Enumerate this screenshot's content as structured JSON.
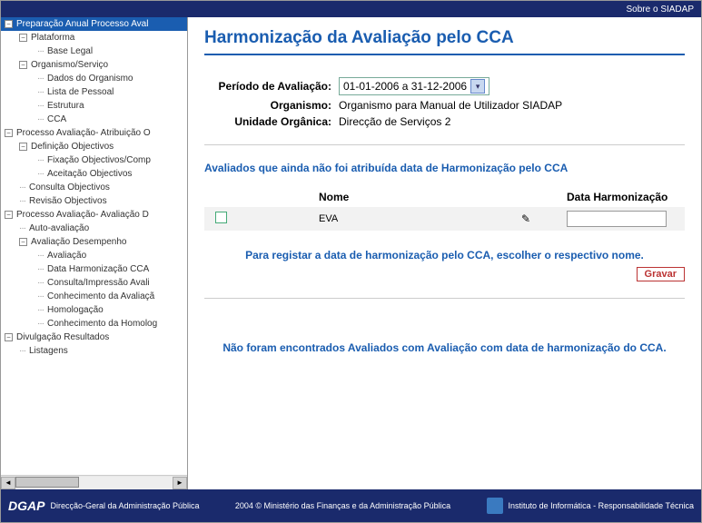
{
  "topbar": {
    "about": "Sobre o SIADAP"
  },
  "tree": [
    {
      "lvl": 0,
      "tog": "−",
      "label": "Preparação Anual Processo Aval",
      "sel": true
    },
    {
      "lvl": 1,
      "tog": "−",
      "label": "Plataforma"
    },
    {
      "lvl": 2,
      "label": "Base Legal"
    },
    {
      "lvl": 1,
      "tog": "−",
      "label": "Organismo/Serviço"
    },
    {
      "lvl": 2,
      "label": "Dados do Organismo"
    },
    {
      "lvl": 2,
      "label": "Lista de Pessoal"
    },
    {
      "lvl": 2,
      "label": "Estrutura"
    },
    {
      "lvl": 2,
      "label": "CCA"
    },
    {
      "lvl": 0,
      "tog": "−",
      "label": "Processo Avaliação- Atribuição O"
    },
    {
      "lvl": 1,
      "tog": "−",
      "label": "Definição Objectivos"
    },
    {
      "lvl": 2,
      "label": "Fixação Objectivos/Comp"
    },
    {
      "lvl": 2,
      "label": "Aceitação Objectivos"
    },
    {
      "lvl": 1,
      "label": "Consulta Objectivos"
    },
    {
      "lvl": 1,
      "label": "Revisão Objectivos"
    },
    {
      "lvl": 0,
      "tog": "−",
      "label": "Processo Avaliação- Avaliação D"
    },
    {
      "lvl": 1,
      "label": "Auto-avaliação"
    },
    {
      "lvl": 1,
      "tog": "−",
      "label": "Avaliação Desempenho"
    },
    {
      "lvl": 2,
      "label": "Avaliação"
    },
    {
      "lvl": 2,
      "label": "Data Harmonização CCA"
    },
    {
      "lvl": 2,
      "label": "Consulta/Impressão Avali"
    },
    {
      "lvl": 2,
      "label": "Conhecimento da Avaliaçã"
    },
    {
      "lvl": 2,
      "label": "Homologação"
    },
    {
      "lvl": 2,
      "label": "Conhecimento da Homolog"
    },
    {
      "lvl": 0,
      "tog": "−",
      "label": "Divulgação Resultados"
    },
    {
      "lvl": 1,
      "label": "Listagens"
    }
  ],
  "page": {
    "title": "Harmonização da Avaliação pelo CCA",
    "period_label": "Período de Avaliação:",
    "period_value": "01-01-2006 a 31-12-2006",
    "org_label": "Organismo:",
    "org_value": "Organismo para Manual de Utilizador SIADAP",
    "unit_label": "Unidade Orgânica:",
    "unit_value": "Direcção de Serviços 2",
    "section1_title": "Avaliados que ainda não foi atribuída data de Harmonização pelo CCA",
    "col_name": "Nome",
    "col_date": "Data Harmonização",
    "row_name": "EVA",
    "row_date": "",
    "instruction": "Para registar a data de harmonização pelo CCA, escolher o respectivo nome.",
    "btn_save": "Gravar",
    "notice": "Não foram encontrados Avaliados com Avaliação com data de harmonização do CCA."
  },
  "footer": {
    "logo": "DGAP",
    "left": "Direcção-Geral da Administração Pública",
    "mid": "2004 © Ministério das Finanças e da Administração Pública",
    "right": "Instituto de Informática - Responsabilidade Técnica"
  }
}
